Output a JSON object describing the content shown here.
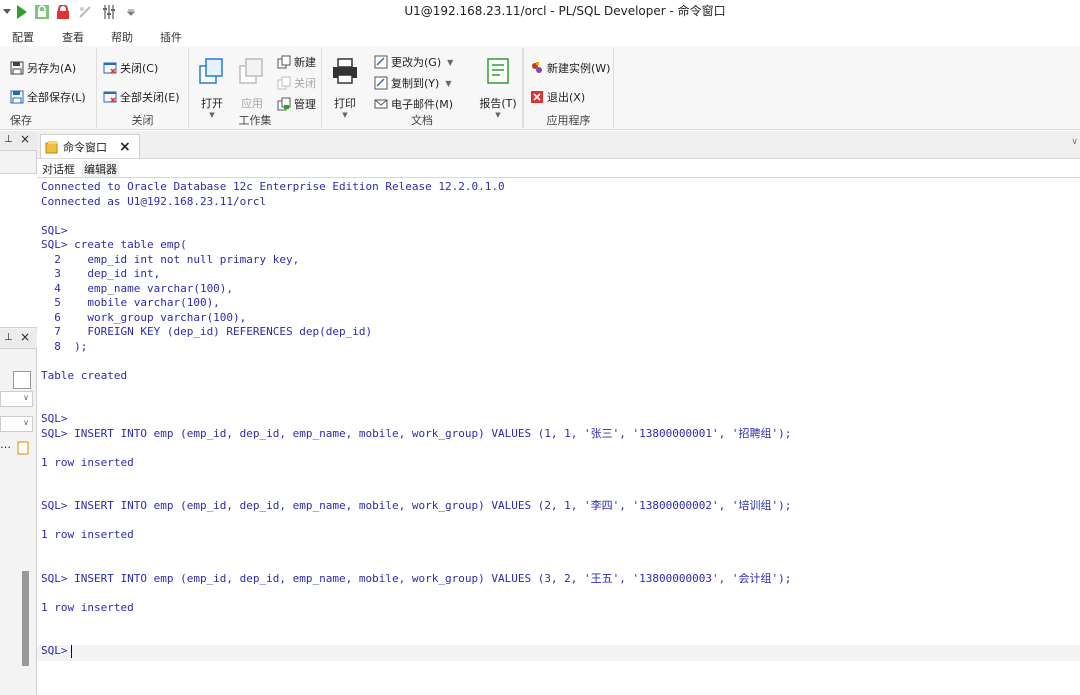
{
  "window": {
    "title": "U1@192.168.23.11/orcl - PL/SQL Developer - 命令窗口"
  },
  "menu": [
    "配置",
    "查看",
    "帮助",
    "插件"
  ],
  "ribbon": {
    "save_as": "另存为(A)",
    "save_all": "全部保存(L)",
    "close": "关闭(C)",
    "close_all": "全部关闭(E)",
    "open": "打开",
    "apply": "应用",
    "new": "新建",
    "close2": "关闭",
    "manage": "管理",
    "print": "打印",
    "change_to": "更改为(G)",
    "copy_to": "复制到(Y)",
    "email": "电子邮件(M)",
    "report": "报告(T)",
    "new_instance": "新建实例(W)",
    "exit": "退出(X)",
    "groups": {
      "save": "保存",
      "close": "关闭",
      "workset": "工作集",
      "document": "文档",
      "app": "应用程序"
    }
  },
  "tab": {
    "label": "命令窗口",
    "close": "×"
  },
  "subtabs": {
    "dialog": "对话框",
    "editor": "编辑器"
  },
  "console": {
    "lines": [
      "Connected to Oracle Database 12c Enterprise Edition Release 12.2.0.1.0",
      "Connected as U1@192.168.23.11/orcl",
      "",
      "SQL>",
      "SQL> create table emp(",
      "  2    emp_id int not null primary key,",
      "  3    dep_id int,",
      "  4    emp_name varchar(100),",
      "  5    mobile varchar(100),",
      "  6    work_group varchar(100),",
      "  7    FOREIGN KEY (dep_id) REFERENCES dep(dep_id)",
      "  8  );",
      "",
      "Table created",
      "",
      "",
      "SQL>",
      "SQL> INSERT INTO emp (emp_id, dep_id, emp_name, mobile, work_group) VALUES (1, 1, '张三', '13800000001', '招聘组');",
      "",
      "1 row inserted",
      "",
      "",
      "SQL> INSERT INTO emp (emp_id, dep_id, emp_name, mobile, work_group) VALUES (2, 1, '李四', '13800000002', '培训组');",
      "",
      "1 row inserted",
      "",
      "",
      "SQL> INSERT INTO emp (emp_id, dep_id, emp_name, mobile, work_group) VALUES (3, 2, '王五', '13800000003', '会计组');",
      "",
      "1 row inserted",
      "",
      "",
      "SQL>"
    ]
  },
  "colors": {
    "console_text": "#2b2bb0",
    "accent": "#1f7fd6",
    "ribbon_bg": "#f7f7f7"
  }
}
